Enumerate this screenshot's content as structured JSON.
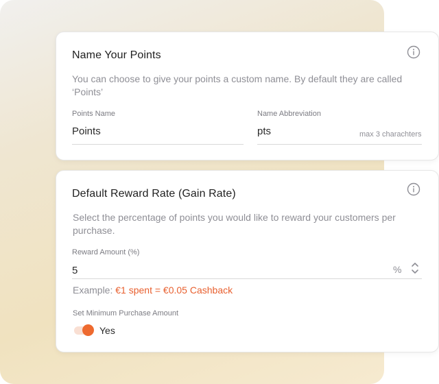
{
  "name_points": {
    "title": "Name Your Points",
    "description": "You can choose to give your points a custom name. By default they are called ‘Points’",
    "points_name": {
      "label": "Points Name",
      "value": "Points"
    },
    "abbreviation": {
      "label": "Name Abbreviation",
      "value": "pts",
      "hint": "max 3 charachters"
    }
  },
  "reward_rate": {
    "title": "Default Reward Rate (Gain Rate)",
    "description": "Select the percentage of points you would like to reward your customers per purchase.",
    "reward_amount": {
      "label": "Reward Amount (%)",
      "value": "5",
      "unit": "%"
    },
    "example": {
      "prefix": "Example: ",
      "spent": "€1 spent = ",
      "cashback": " €0.05 Cashback"
    },
    "min_purchase": {
      "label": "Set Minimum Purchase Amount",
      "toggle_label": "Yes",
      "enabled": true
    }
  },
  "colors": {
    "accent": "#ee6a2f",
    "text_primary": "#1f1f1f",
    "text_muted": "#8e8e95"
  },
  "icons": [
    "info-icon",
    "stepper-icon",
    "toggle-switch"
  ]
}
